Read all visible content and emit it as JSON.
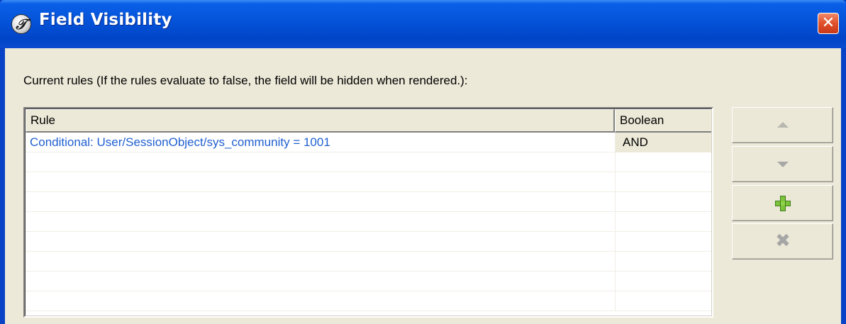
{
  "window": {
    "title": "Field Visibility",
    "close_glyph": "✕"
  },
  "rules_label": "Current rules (If the rules evaluate to false, the field will be hidden when rendered.):",
  "table": {
    "columns": [
      "Rule",
      "Boolean"
    ],
    "rows": [
      {
        "rule": "Conditional: User/SessionObject/sys_community = 1001",
        "boolean": "AND"
      },
      {
        "rule": "",
        "boolean": ""
      },
      {
        "rule": "",
        "boolean": ""
      },
      {
        "rule": "",
        "boolean": ""
      },
      {
        "rule": "",
        "boolean": ""
      },
      {
        "rule": "",
        "boolean": ""
      },
      {
        "rule": "",
        "boolean": ""
      },
      {
        "rule": "",
        "boolean": ""
      },
      {
        "rule": "",
        "boolean": ""
      }
    ]
  },
  "buttons": {
    "move_up": "triangle-up-icon",
    "move_down": "triangle-down-icon",
    "add": "plus-icon",
    "delete": "x-icon",
    "delete_glyph": "✖"
  },
  "colors": {
    "titlebar": "#0453d8",
    "rule_text": "#2060d0",
    "background": "#ece9d8"
  }
}
